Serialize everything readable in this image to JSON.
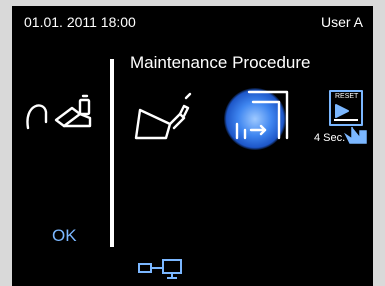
{
  "status_bar": {
    "datetime": "01.01. 2011 18:00",
    "user": "User A"
  },
  "main": {
    "title": "Maintenance Procedure",
    "ok_label": "OK",
    "reset_label": "RESET",
    "reset_time": "4 Sec."
  },
  "icons": {
    "dentist_tools": "dental-instruments-icon",
    "maintenance": "maintenance-handpiece-icon",
    "flush": "flush-procedure-icon",
    "reset": "reset-4sec-icon",
    "network": "network-connection-icon"
  },
  "colors": {
    "screen_bg": "#000000",
    "frame_bg": "#d9d9d9",
    "accent": "#7bb7ff",
    "active_glow": "#3f86f0",
    "text": "#ffffff"
  }
}
